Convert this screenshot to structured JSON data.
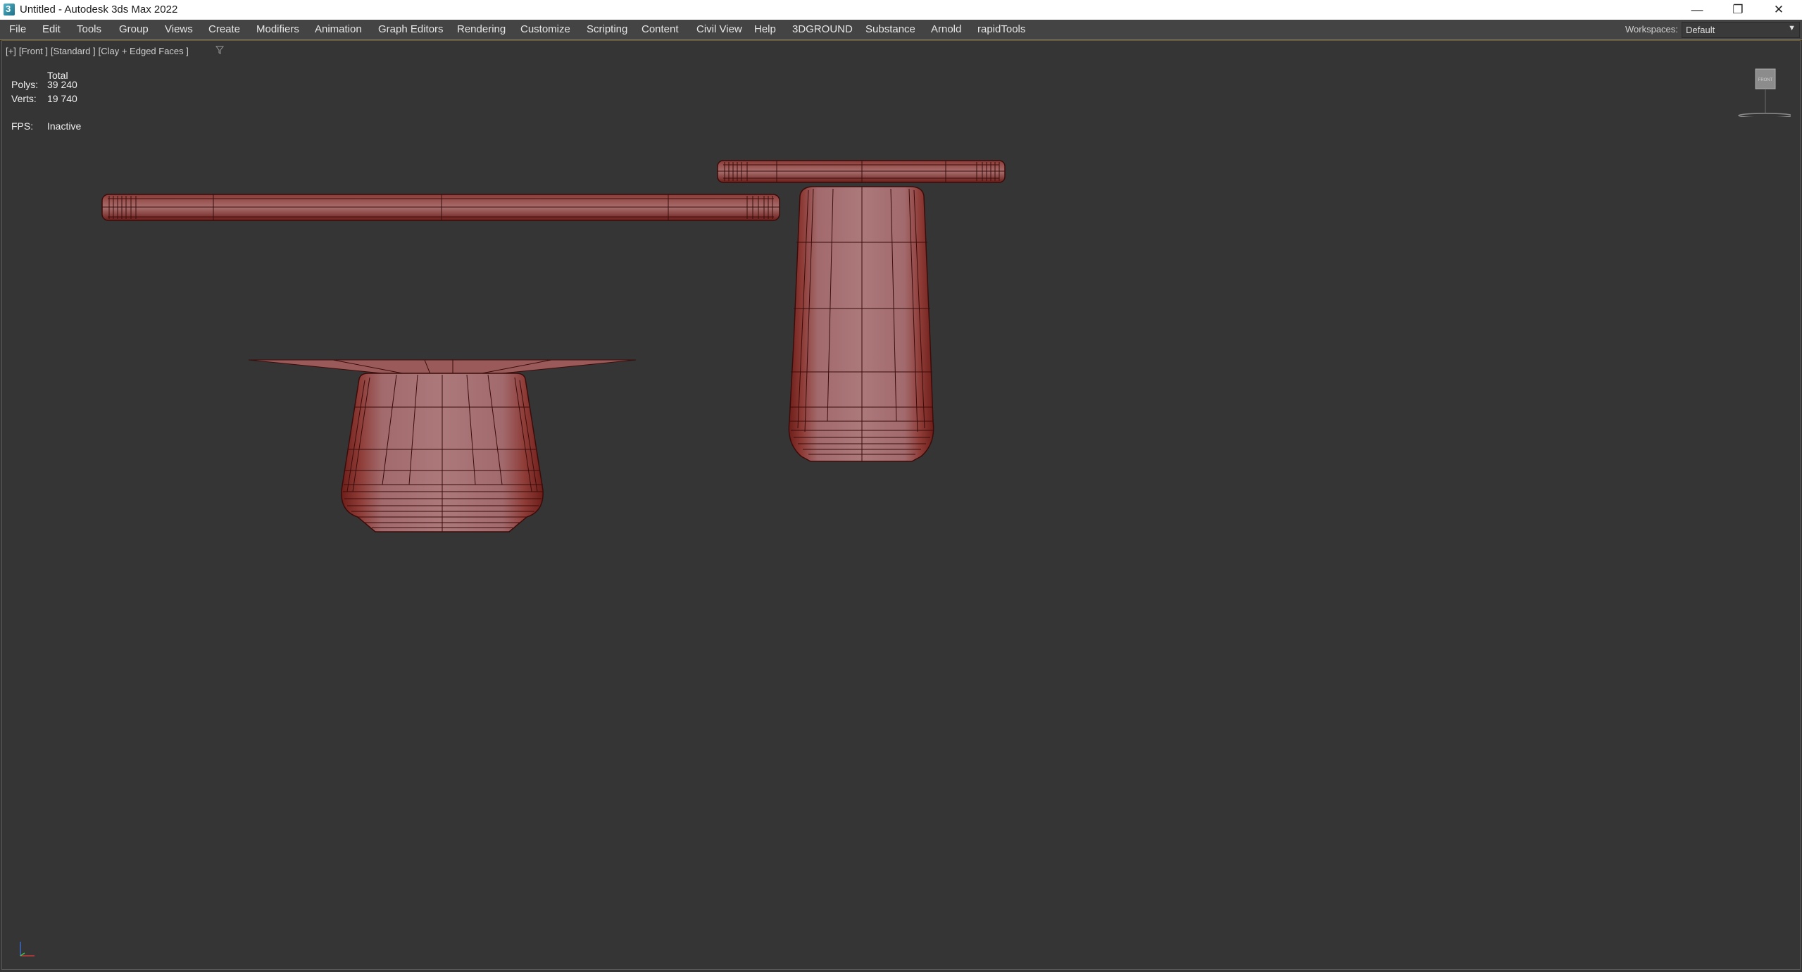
{
  "window": {
    "title": "Untitled - Autodesk 3ds Max 2022",
    "app_icon_glyph": "3",
    "controls": {
      "minimize": "—",
      "restore": "❐",
      "close": "✕"
    }
  },
  "menubar": {
    "items": [
      "File",
      "Edit",
      "Tools",
      "Group",
      "Views",
      "Create",
      "Modifiers",
      "Animation",
      "Graph Editors",
      "Rendering",
      "Customize",
      "Scripting",
      "Content",
      "Civil View",
      "Help",
      "3DGROUND",
      "Substance",
      "Arnold",
      "rapidTools"
    ],
    "workspaces_label": "Workspaces:",
    "workspaces_value": "Default"
  },
  "viewport": {
    "label": {
      "plus": "[+]",
      "view": "[Front ]",
      "shading_mode": "[Standard ]",
      "style": "[Clay + Edged Faces ]"
    },
    "stats": {
      "header": "Total",
      "polys_label": "Polys:",
      "polys_value": "39 240",
      "verts_label": "Verts:",
      "verts_value": "19 740",
      "fps_label": "FPS:",
      "fps_value": "Inactive"
    },
    "viewcube_label": "FRONT"
  },
  "colors": {
    "background": "#353535",
    "mesh_fill": "#a36e72",
    "mesh_dark": "#7a2420",
    "mesh_edge": "#3a0c0a",
    "menubar": "#444444",
    "menubar_accent": "#8c7a3c"
  },
  "icons": [
    "app-icon",
    "filter-icon",
    "viewcube-icon",
    "axis-tripod-icon"
  ]
}
